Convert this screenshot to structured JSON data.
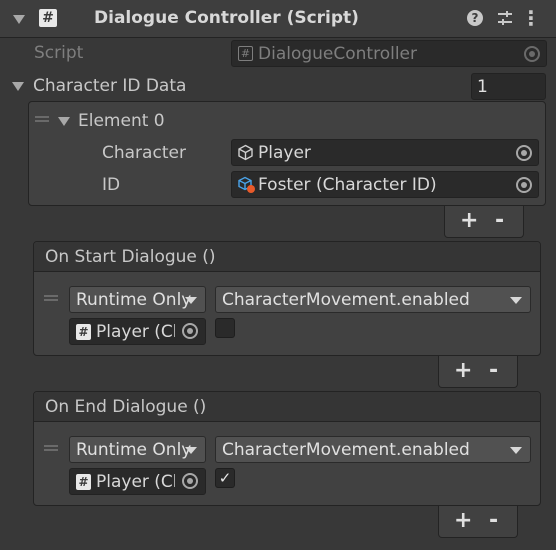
{
  "component": {
    "title": "Dialogue Controller (Script)",
    "hash_glyph": "#",
    "help_glyph": "?",
    "menu_glyph": "⋮"
  },
  "script_row": {
    "label": "Script",
    "value": "DialogueController"
  },
  "character_id_data": {
    "label": "Character ID Data",
    "size": "1",
    "element": {
      "label": "Element 0",
      "character_label": "Character",
      "character_value": "Player",
      "id_label": "ID",
      "id_value": "Foster (Character ID)"
    },
    "plus": "+",
    "minus": "-"
  },
  "on_start": {
    "header": "On Start Dialogue ()",
    "runtime_option": "Runtime Only",
    "function": "CharacterMovement.enabled",
    "object": "Player (Character)",
    "checked": false,
    "plus": "+",
    "minus": "-"
  },
  "on_end": {
    "header": "On End Dialogue ()",
    "runtime_option": "Runtime Only",
    "function": "CharacterMovement.enabled",
    "object": "Player (Character)",
    "checked": true,
    "check_glyph": "✓",
    "plus": "+",
    "minus": "-"
  }
}
